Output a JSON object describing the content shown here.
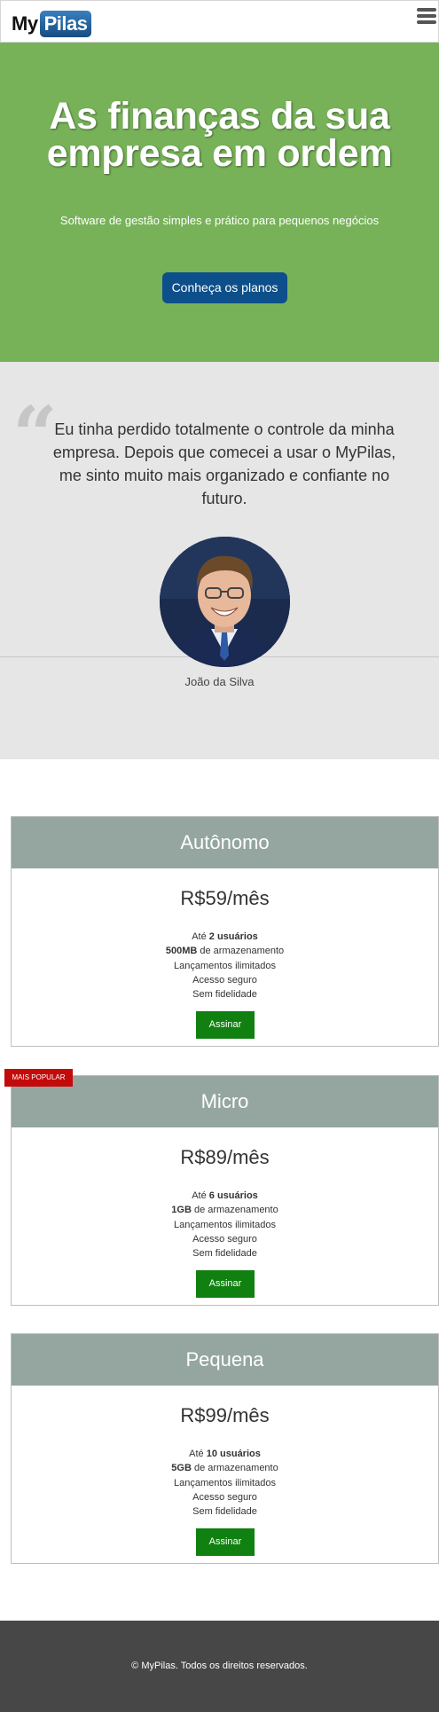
{
  "header": {
    "logo_my": "My",
    "logo_pilas": "Pilas",
    "menu_icon": "hamburger-menu-icon"
  },
  "hero": {
    "title_line1": "As finanças da sua",
    "title_line2": "empresa em ordem",
    "subtitle": "Software de gestão simples e prático para pequenos negócios",
    "cta_label": "Conheça os planos"
  },
  "testimonial": {
    "quote_icon": "quote-icon",
    "text": "Eu tinha perdido totalmente o controle da minha empresa. Depois que comecei a usar o MyPilas, me sinto muito mais organizado e confiante no futuro.",
    "author": "João da Silva"
  },
  "plans": [
    {
      "name": "Autônomo",
      "price": "R$59/mês",
      "users_prefix": "Até ",
      "users_bold": "2 usuários",
      "storage_bold": "500MB",
      "storage_suffix": " de armazenamento",
      "feature_3": "Lançamentos ilimitados",
      "feature_4": "Acesso seguro",
      "feature_5": "Sem fidelidade",
      "button": "Assinar"
    },
    {
      "name": "Micro",
      "price": "R$89/mês",
      "users_prefix": "Até ",
      "users_bold": "6 usuários",
      "storage_bold": "1GB",
      "storage_suffix": " de armazenamento",
      "feature_3": "Lançamentos ilimitados",
      "feature_4": "Acesso seguro",
      "feature_5": "Sem fidelidade",
      "button": "Assinar",
      "badge": "MAIS POPULAR"
    },
    {
      "name": "Pequena",
      "price": "R$99/mês",
      "users_prefix": "Até ",
      "users_bold": "10 usuários",
      "storage_bold": "5GB",
      "storage_suffix": " de armazenamento",
      "feature_3": "Lançamentos ilimitados",
      "feature_4": "Acesso seguro",
      "feature_5": "Sem fidelidade",
      "button": "Assinar"
    }
  ],
  "footer": {
    "copyright": "© MyPilas. Todos os direitos reservados."
  },
  "colors": {
    "hero_bg": "#77b259",
    "cta_bg": "#0d4f8a",
    "card_header_bg": "#95a6a1",
    "assinar_bg": "#108010",
    "badge_bg": "#c40b0b",
    "footer_bg": "#474747"
  }
}
